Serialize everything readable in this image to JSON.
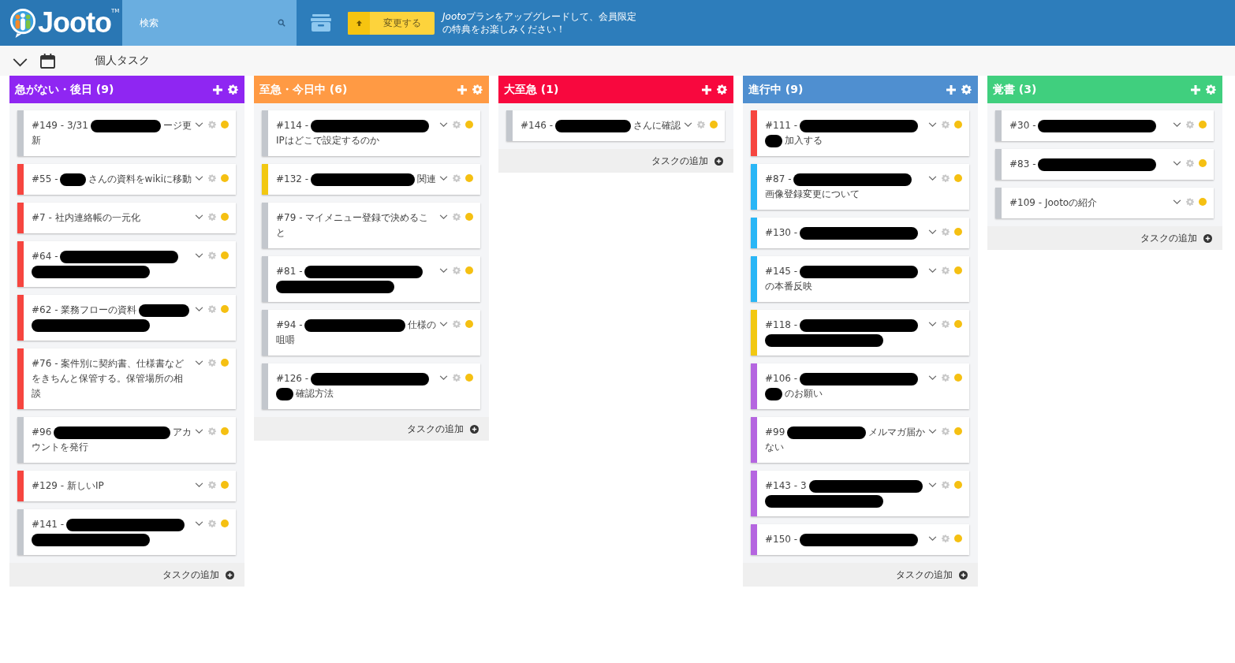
{
  "header": {
    "logo": "Jooto",
    "logo_mark": "TM",
    "search": {
      "placeholder": "検索"
    },
    "upgrade_button": "変更する",
    "promo": {
      "brand": "Jooto",
      "line_1": "プランをアップグレードして、会員限定",
      "line_2": "の特典をお楽しみください！"
    }
  },
  "subbar": {
    "title": "個人タスク"
  },
  "columns": [
    {
      "title": "急がない・後日 (9)",
      "color": "#8f26f2",
      "add_label": "タスクの追加",
      "cards": [
        {
          "color": "#c3c7cd",
          "lines": [
            [
              {
                "kind": "text",
                "text": "#149 - 3/31"
              },
              {
                "kind": "redaction"
              },
              {
                "kind": "text",
                "text": "ージ更"
              }
            ],
            [
              {
                "kind": "text",
                "text": "新"
              }
            ]
          ]
        },
        {
          "color": "#f6453f",
          "lines": [
            [
              {
                "kind": "text",
                "text": "#55 -"
              },
              {
                "kind": "redaction"
              },
              {
                "kind": "text",
                "text": "さんの資料をwikiに移動"
              }
            ]
          ]
        },
        {
          "color": "#f6453f",
          "lines": [
            [
              {
                "kind": "text",
                "text": "#7 - 社内連絡帳の一元化"
              }
            ]
          ]
        },
        {
          "color": "#f6453f",
          "lines": [
            [
              {
                "kind": "text",
                "text": "#64 -"
              },
              {
                "kind": "redaction"
              }
            ],
            [
              {
                "kind": "redaction"
              }
            ]
          ]
        },
        {
          "color": "#f6453f",
          "lines": [
            [
              {
                "kind": "text",
                "text": "#62 - 業務フローの資料"
              },
              {
                "kind": "redaction"
              }
            ],
            [
              {
                "kind": "redaction"
              }
            ]
          ]
        },
        {
          "color": "#f6453f",
          "lines": [
            [
              {
                "kind": "text",
                "text": "#76 - 案件別に契約書、仕様書など"
              }
            ],
            [
              {
                "kind": "text",
                "text": "をきちんと保管する。保管場所の相"
              }
            ],
            [
              {
                "kind": "text",
                "text": "談"
              }
            ]
          ]
        },
        {
          "color": "#c3c7cd",
          "lines": [
            [
              {
                "kind": "text",
                "text": "#96"
              },
              {
                "kind": "redaction"
              },
              {
                "kind": "text",
                "text": "アカ"
              }
            ],
            [
              {
                "kind": "text",
                "text": "ウントを発行"
              }
            ]
          ]
        },
        {
          "color": "#f6453f",
          "lines": [
            [
              {
                "kind": "text",
                "text": "#129 - 新しいIP"
              }
            ]
          ]
        },
        {
          "color": "#c3c7cd",
          "lines": [
            [
              {
                "kind": "text",
                "text": "#141 -"
              },
              {
                "kind": "redaction"
              }
            ],
            [
              {
                "kind": "redaction"
              }
            ]
          ]
        }
      ]
    },
    {
      "title": "至急・今日中 (6)",
      "color": "#ff9a44",
      "add_label": "タスクの追加",
      "cards": [
        {
          "color": "#c3c7cd",
          "lines": [
            [
              {
                "kind": "text",
                "text": "#114 -"
              },
              {
                "kind": "redaction"
              }
            ],
            [
              {
                "kind": "text",
                "text": "IPはどこで設定するのか"
              }
            ]
          ]
        },
        {
          "color": "#f2c811",
          "lines": [
            [
              {
                "kind": "text",
                "text": "#132 -"
              },
              {
                "kind": "redaction"
              },
              {
                "kind": "text",
                "text": "関連"
              }
            ]
          ]
        },
        {
          "color": "#c3c7cd",
          "lines": [
            [
              {
                "kind": "text",
                "text": "#79 - マイメニュー登録で決めるこ"
              }
            ],
            [
              {
                "kind": "text",
                "text": "と"
              }
            ]
          ]
        },
        {
          "color": "#c3c7cd",
          "lines": [
            [
              {
                "kind": "text",
                "text": "#81 -"
              },
              {
                "kind": "redaction"
              }
            ],
            [
              {
                "kind": "redaction"
              }
            ]
          ]
        },
        {
          "color": "#c3c7cd",
          "lines": [
            [
              {
                "kind": "text",
                "text": "#94 -"
              },
              {
                "kind": "redaction"
              },
              {
                "kind": "text",
                "text": "仕様の"
              }
            ],
            [
              {
                "kind": "text",
                "text": "咀嚼"
              }
            ]
          ]
        },
        {
          "color": "#c3c7cd",
          "lines": [
            [
              {
                "kind": "text",
                "text": "#126 -"
              },
              {
                "kind": "redaction"
              }
            ],
            [
              {
                "kind": "redaction"
              },
              {
                "kind": "text",
                "text": "確認方法"
              }
            ]
          ]
        }
      ]
    },
    {
      "title": "大至急 (1)",
      "color": "#f8083e",
      "add_label": "タスクの追加",
      "cards": [
        {
          "color": "#c3c7cd",
          "lines": [
            [
              {
                "kind": "text",
                "text": "#146 -"
              },
              {
                "kind": "redaction"
              },
              {
                "kind": "text",
                "text": "さんに確認"
              }
            ]
          ]
        }
      ]
    },
    {
      "title": "進行中 (9)",
      "color": "#4f8fd0",
      "add_label": "タスクの追加",
      "cards": [
        {
          "color": "#f6453f",
          "lines": [
            [
              {
                "kind": "text",
                "text": "#111 -"
              },
              {
                "kind": "redaction"
              }
            ],
            [
              {
                "kind": "redaction"
              },
              {
                "kind": "text",
                "text": "加入する"
              }
            ]
          ]
        },
        {
          "color": "#29b6f6",
          "lines": [
            [
              {
                "kind": "text",
                "text": "#87 -"
              },
              {
                "kind": "redaction"
              }
            ],
            [
              {
                "kind": "text",
                "text": "画像登録変更について"
              }
            ]
          ]
        },
        {
          "color": "#29b6f6",
          "lines": [
            [
              {
                "kind": "text",
                "text": "#130 -"
              },
              {
                "kind": "redaction"
              }
            ]
          ]
        },
        {
          "color": "#29b6f6",
          "lines": [
            [
              {
                "kind": "text",
                "text": "#145 -"
              },
              {
                "kind": "redaction"
              }
            ],
            [
              {
                "kind": "text",
                "text": "の本番反映"
              }
            ]
          ]
        },
        {
          "color": "#f2c811",
          "lines": [
            [
              {
                "kind": "text",
                "text": "#118 -"
              },
              {
                "kind": "redaction"
              }
            ],
            [
              {
                "kind": "redaction"
              }
            ]
          ]
        },
        {
          "color": "#b565e0",
          "lines": [
            [
              {
                "kind": "text",
                "text": "#106 -"
              },
              {
                "kind": "redaction"
              }
            ],
            [
              {
                "kind": "redaction"
              },
              {
                "kind": "text",
                "text": "のお願い"
              }
            ]
          ]
        },
        {
          "color": "#b565e0",
          "lines": [
            [
              {
                "kind": "text",
                "text": "#99"
              },
              {
                "kind": "redaction"
              },
              {
                "kind": "text",
                "text": "メルマガ届か"
              }
            ],
            [
              {
                "kind": "text",
                "text": "ない"
              }
            ]
          ]
        },
        {
          "color": "#b565e0",
          "lines": [
            [
              {
                "kind": "text",
                "text": "#143 - 3"
              },
              {
                "kind": "redaction"
              }
            ],
            [
              {
                "kind": "redaction"
              }
            ]
          ]
        },
        {
          "color": "#b565e0",
          "lines": [
            [
              {
                "kind": "text",
                "text": "#150 -"
              },
              {
                "kind": "redaction"
              }
            ]
          ]
        }
      ]
    },
    {
      "title": "覚書 (3)",
      "color": "#40cf7e",
      "add_label": "タスクの追加",
      "cards": [
        {
          "color": "#c3c7cd",
          "lines": [
            [
              {
                "kind": "text",
                "text": "#30 -"
              },
              {
                "kind": "redaction"
              }
            ]
          ]
        },
        {
          "color": "#c3c7cd",
          "lines": [
            [
              {
                "kind": "text",
                "text": "#83 -"
              },
              {
                "kind": "redaction"
              }
            ]
          ]
        },
        {
          "color": "#c3c7cd",
          "lines": [
            [
              {
                "kind": "text",
                "text": "#109 - Jootoの紹介"
              }
            ]
          ]
        }
      ]
    }
  ]
}
